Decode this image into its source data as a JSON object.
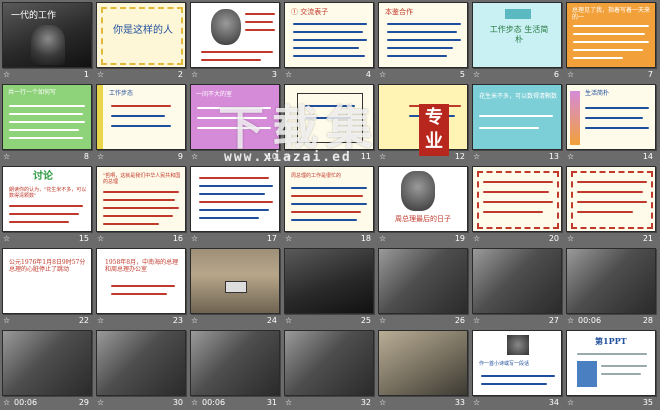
{
  "colors": {
    "background": "#6b6b6b",
    "thumb_border": "#2b2b2b",
    "label_text": "#ffffff",
    "accent_red": "#c0392b",
    "accent_blue": "#1f4f9c"
  },
  "watermark": {
    "cn": "下载集",
    "badge": "专业",
    "url": "www.xiazai.ed"
  },
  "slides": [
    {
      "num": "1",
      "title": "一代的工作"
    },
    {
      "num": "2",
      "title": "你是这样的人"
    },
    {
      "num": "3"
    },
    {
      "num": "4",
      "title": "① 交流表子"
    },
    {
      "num": "5",
      "title": "本鉴合作"
    },
    {
      "num": "6",
      "title": "工作步态 生活简朴"
    },
    {
      "num": "7",
      "text": "总理见了我，指着写着一天来的一"
    },
    {
      "num": "8",
      "text": "共一行一个如何写"
    },
    {
      "num": "9",
      "title": "工作步态"
    },
    {
      "num": "10",
      "text": "一间不大的室"
    },
    {
      "num": "11"
    },
    {
      "num": "12"
    },
    {
      "num": "13",
      "text": "花生米不多，可以数得清颗数"
    },
    {
      "num": "14",
      "title": "生活简朴"
    },
    {
      "num": "15",
      "title": "讨论",
      "text": "朗读你的认为，\"花生米不多，可以数得清颗数\""
    },
    {
      "num": "16",
      "text": "\"哲啊，这就是我们中华人民共和国的总理"
    },
    {
      "num": "17"
    },
    {
      "num": "18",
      "text": "周总理的工作是很忙的"
    },
    {
      "num": "19",
      "title": "周总理最后的日子"
    },
    {
      "num": "20"
    },
    {
      "num": "21"
    },
    {
      "num": "22",
      "text": "公元1976年1月8日9时57分 总理的心脏停止了跳动"
    },
    {
      "num": "23",
      "text": "1958年8月，中南海的总理和周总理办公室"
    },
    {
      "num": "24"
    },
    {
      "num": "25"
    },
    {
      "num": "26"
    },
    {
      "num": "27"
    },
    {
      "num": "28",
      "duration": "00:06"
    },
    {
      "num": "29",
      "duration": "00:06"
    },
    {
      "num": "30"
    },
    {
      "num": "31",
      "duration": "00:06"
    },
    {
      "num": "32"
    },
    {
      "num": "33"
    },
    {
      "num": "34",
      "text": "作一首小诗或写一段话"
    },
    {
      "num": "35",
      "title": "第1PPT"
    }
  ],
  "star_glyph": "☆"
}
